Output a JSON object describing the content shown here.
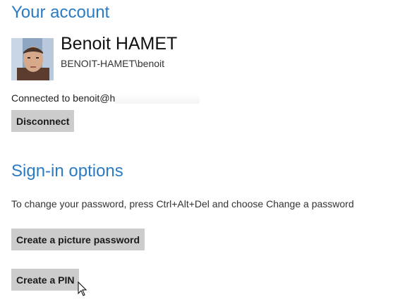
{
  "account": {
    "section_title": "Your account",
    "user_name": "Benoit HAMET",
    "user_domain": "BENOIT-HAMET\\benoit",
    "connected_text": "Connected to benoit@h"
  },
  "buttons": {
    "disconnect": "Disconnect",
    "picture_password": "Create a picture password",
    "pin": "Create a PIN"
  },
  "signin": {
    "section_title": "Sign-in options",
    "help_text": "To change your password, press Ctrl+Alt+Del and choose Change a password"
  },
  "colors": {
    "accent": "#2a7bc4",
    "button_bg": "#cccccc"
  },
  "icons": {
    "cursor": "arrow-pointer"
  }
}
